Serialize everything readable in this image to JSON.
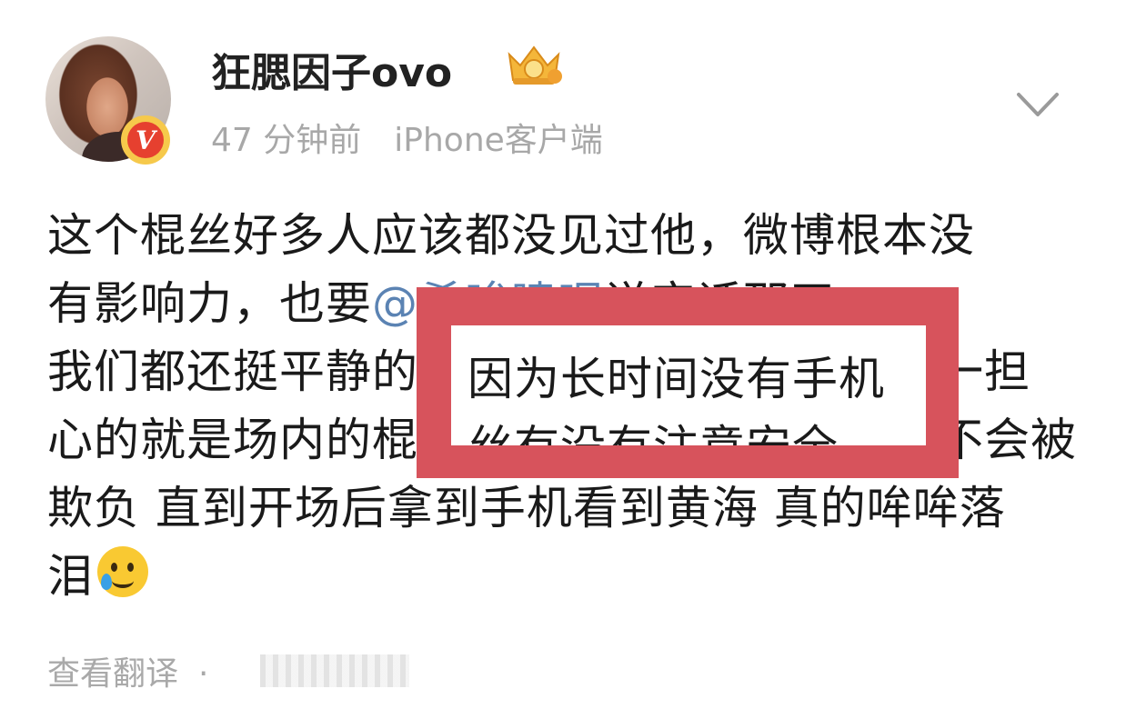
{
  "post": {
    "author": {
      "name": "狂腮因子ovo",
      "badge_icon": "gold-crown-badge-icon",
      "verified_icon": "verified-v-badge-icon"
    },
    "meta": {
      "time": "47 分钟前",
      "source": "iPhone客户端"
    },
    "menu_icon": "chevron-down-icon",
    "text_lines": [
      "这个棍丝好多人应该都没见过他，微博根本没",
      "有影响力，也要",
      "我们都还挺平静的",
      "心的就是场内的棍",
      "欺负 直到开场后拿到手机看到黄海 真的哞哞落",
      "泪"
    ],
    "line2_partial": "说实话那天",
    "line3_after": "唯一担",
    "line4_after": "会不会被",
    "mention_partial": "@希哞啸呢",
    "highlight_text": "因为长时间没有手机",
    "highlight_second_line": "丝有没有注意安全",
    "emoji": "crying-smile-emoji-icon",
    "footer": {
      "translate": "查看翻译",
      "separator": "·"
    }
  },
  "colors": {
    "highlight_box": "#d7535c",
    "meta_text": "#a8a8a8",
    "mention": "#5b83b3"
  }
}
